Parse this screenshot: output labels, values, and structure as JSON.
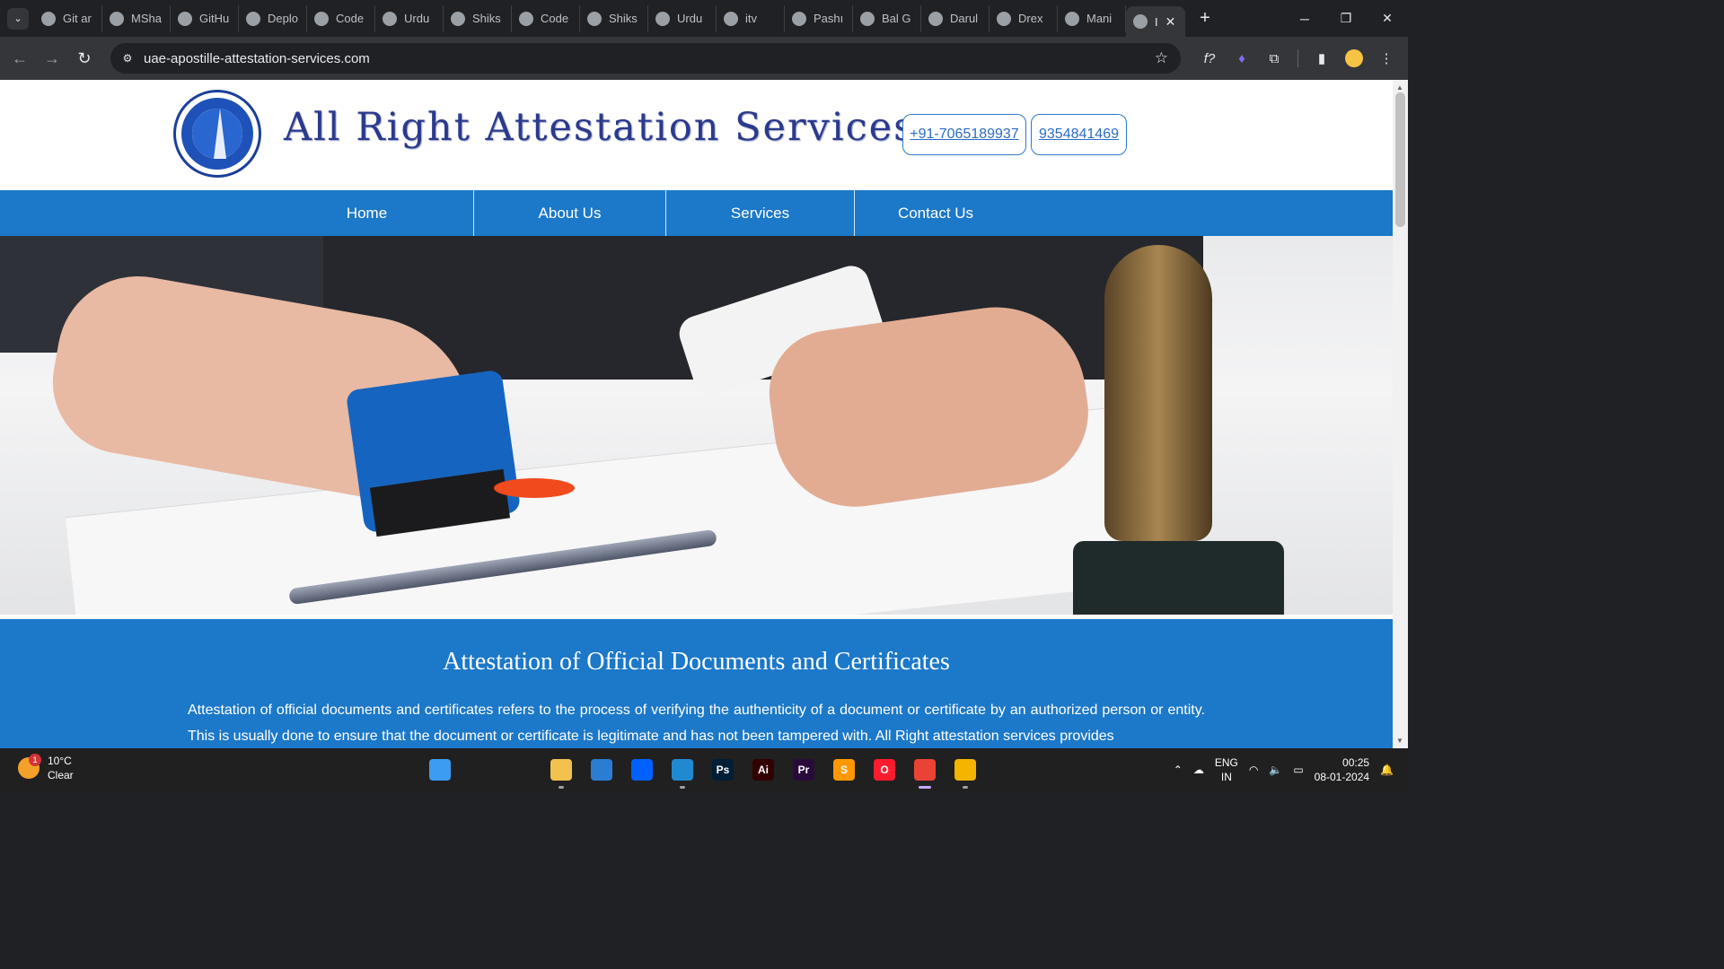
{
  "browser": {
    "tabs": [
      {
        "label": "Git ar",
        "icon": "code-braces-icon"
      },
      {
        "label": "MSha",
        "icon": "github-icon"
      },
      {
        "label": "GitHu",
        "icon": "github-icon"
      },
      {
        "label": "Deplo",
        "icon": "deploy-icon"
      },
      {
        "label": "Code",
        "icon": "globe-icon"
      },
      {
        "label": "Urdu",
        "icon": "globe-icon"
      },
      {
        "label": "Shiks",
        "icon": "globe-icon"
      },
      {
        "label": "Code",
        "icon": "globe-icon"
      },
      {
        "label": "Shiks",
        "icon": "globe-icon"
      },
      {
        "label": "Urdu",
        "icon": "globe-icon"
      },
      {
        "label": "itv",
        "icon": "itv-icon"
      },
      {
        "label": "Pashı",
        "icon": "pashto-icon"
      },
      {
        "label": "Bal G",
        "icon": "balg-icon"
      },
      {
        "label": "Darul",
        "icon": "globe-icon"
      },
      {
        "label": "Drex",
        "icon": "globe-icon"
      },
      {
        "label": "Mani",
        "icon": "globe-icon"
      },
      {
        "label": "I",
        "icon": "site-favicon-icon",
        "active": true
      }
    ],
    "new_tab_label": "+",
    "url": "uae-apostille-attestation-services.com",
    "window_controls": {
      "minimize": "─",
      "restore": "❐",
      "close": "✕"
    }
  },
  "site": {
    "brand_title": "All Right Attestation Services",
    "phones": [
      "+91-7065189937",
      "9354841469"
    ],
    "nav": [
      "Home",
      "About Us",
      "Services",
      "Contact Us"
    ],
    "section": {
      "heading": "Attestation of Official Documents and Certificates",
      "body": "Attestation of official documents and certificates refers to the process of verifying the authenticity of a document or certificate by an authorized person or entity. This is usually done to ensure that the document or certificate is legitimate and has not been tampered with. All Right attestation services provides"
    }
  },
  "taskbar": {
    "weather": {
      "temp": "10°C",
      "condition": "Clear",
      "badge": "1"
    },
    "apps": [
      {
        "name": "windows-start",
        "label": "",
        "color": "#3b9cf0"
      },
      {
        "name": "search",
        "label": "",
        "color": "#202020"
      },
      {
        "name": "task-view",
        "label": "",
        "color": "#202020"
      },
      {
        "name": "file-explorer",
        "label": "",
        "color": "#f2c14e"
      },
      {
        "name": "microsoft-store",
        "label": "",
        "color": "#2b7cd3"
      },
      {
        "name": "dropbox",
        "label": "",
        "color": "#0061fe"
      },
      {
        "name": "vscode",
        "label": "",
        "color": "#1f8ad2"
      },
      {
        "name": "photoshop",
        "label": "Ps",
        "color": "#001e36"
      },
      {
        "name": "illustrator",
        "label": "Ai",
        "color": "#330000"
      },
      {
        "name": "premiere",
        "label": "Pr",
        "color": "#2a0a3b"
      },
      {
        "name": "sublime",
        "label": "S",
        "color": "#ff9800"
      },
      {
        "name": "opera",
        "label": "O",
        "color": "#ff1b2d"
      },
      {
        "name": "chrome",
        "label": "",
        "color": "#ea4335"
      },
      {
        "name": "git-client",
        "label": "",
        "color": "#f4b400"
      }
    ],
    "lang": {
      "line1": "ENG",
      "line2": "IN"
    },
    "time": "00:25",
    "date": "08-01-2024"
  },
  "colors": {
    "accent_blue": "#1c78c8",
    "brand_navy": "#2b3a8c"
  }
}
